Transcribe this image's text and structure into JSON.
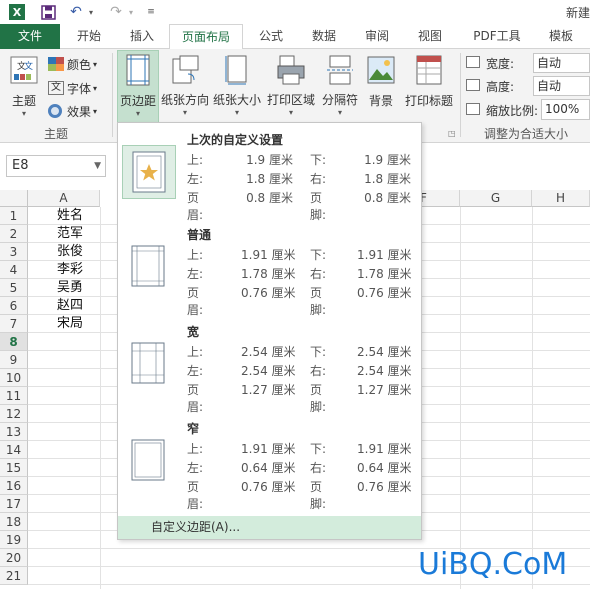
{
  "title_bar": {
    "app_title": "新建"
  },
  "tabs": [
    "文件",
    "开始",
    "插入",
    "页面布局",
    "公式",
    "数据",
    "审阅",
    "视图",
    "PDF工具",
    "模板"
  ],
  "ribbon": {
    "theme_group": {
      "label": "主题",
      "theme_btn": "主题",
      "colors": "颜色",
      "fonts": "字体",
      "effects": "效果"
    },
    "buttons": {
      "margins": "页边距",
      "orientation": "纸张方向",
      "size": "纸张大小",
      "print_area": "打印区域",
      "breaks": "分隔符",
      "background": "背景",
      "print_titles": "打印标题"
    },
    "scale_group": {
      "label": "调整为合适大小",
      "width_label": "宽度:",
      "width_value": "自动",
      "height_label": "高度:",
      "height_value": "自动",
      "scale_label": "缩放比例:",
      "scale_value": "100%"
    }
  },
  "namebox": "E8",
  "columns": [
    "A",
    "F",
    "G",
    "H"
  ],
  "rows": [
    "1",
    "2",
    "3",
    "4",
    "5",
    "6",
    "7",
    "8",
    "9",
    "10",
    "11",
    "12",
    "13",
    "14",
    "15",
    "16",
    "17",
    "18",
    "19",
    "20",
    "21"
  ],
  "selected_row": "8",
  "cells_a": [
    "姓名",
    "范军",
    "张俊",
    "李彩",
    "吴勇",
    "赵四",
    "宋局"
  ],
  "presets": [
    {
      "title": "上次的自定义设置",
      "top_k": "上:",
      "top": "1.9 厘米",
      "bottom_k": "下:",
      "bottom": "1.9 厘米",
      "left_k": "左:",
      "left": "1.8 厘米",
      "right_k": "右:",
      "right": "1.8 厘米",
      "header_k": "页眉:",
      "header": "0.8 厘米",
      "footer_k": "页脚:",
      "footer": "0.8 厘米"
    },
    {
      "title": "普通",
      "top_k": "上:",
      "top": "1.91 厘米",
      "bottom_k": "下:",
      "bottom": "1.91 厘米",
      "left_k": "左:",
      "left": "1.78 厘米",
      "right_k": "右:",
      "right": "1.78 厘米",
      "header_k": "页眉:",
      "header": "0.76 厘米",
      "footer_k": "页脚:",
      "footer": "0.76 厘米"
    },
    {
      "title": "宽",
      "top_k": "上:",
      "top": "2.54 厘米",
      "bottom_k": "下:",
      "bottom": "2.54 厘米",
      "left_k": "左:",
      "left": "2.54 厘米",
      "right_k": "右:",
      "right": "2.54 厘米",
      "header_k": "页眉:",
      "header": "1.27 厘米",
      "footer_k": "页脚:",
      "footer": "1.27 厘米"
    },
    {
      "title": "窄",
      "top_k": "上:",
      "top": "1.91 厘米",
      "bottom_k": "下:",
      "bottom": "1.91 厘米",
      "left_k": "左:",
      "left": "0.64 厘米",
      "right_k": "右:",
      "right": "0.64 厘米",
      "header_k": "页眉:",
      "header": "0.76 厘米",
      "footer_k": "页脚:",
      "footer": "0.76 厘米"
    }
  ],
  "custom_margins": "自定义边距(A)...",
  "watermark": "UiBQ.CoM",
  "colors": {
    "accent": "#217346",
    "hover": "#d3ecdc",
    "watermark": "#1a7ad8"
  }
}
